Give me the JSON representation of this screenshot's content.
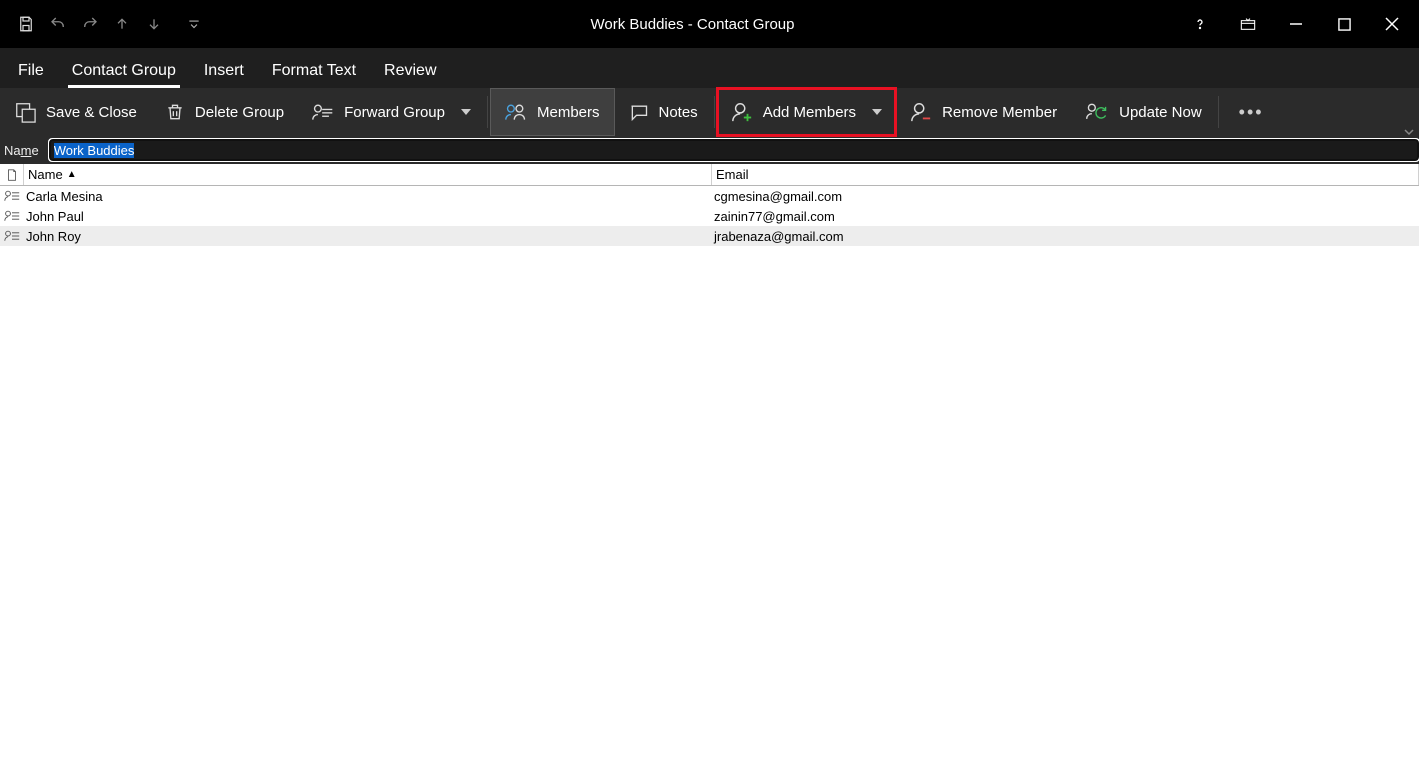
{
  "title": {
    "text": "Work Buddies  -  Contact Group"
  },
  "tabs": {
    "file": "File",
    "contact_group": "Contact Group",
    "insert": "Insert",
    "format_text": "Format Text",
    "review": "Review"
  },
  "ribbon": {
    "save_close": "Save & Close",
    "delete_group": "Delete Group",
    "forward_group": "Forward Group",
    "members": "Members",
    "notes": "Notes",
    "add_members": "Add Members",
    "remove_member": "Remove Member",
    "update_now": "Update Now"
  },
  "name_field": {
    "label_pre": "Na",
    "label_u": "m",
    "label_post": "e",
    "value": "Work Buddies"
  },
  "columns": {
    "name": "Name",
    "email": "Email"
  },
  "rows": [
    {
      "name": "Carla Mesina",
      "email": "cgmesina@gmail.com",
      "selected": false
    },
    {
      "name": "John Paul",
      "email": "zainin77@gmail.com",
      "selected": false
    },
    {
      "name": "John Roy",
      "email": "jrabenaza@gmail.com",
      "selected": true
    }
  ]
}
